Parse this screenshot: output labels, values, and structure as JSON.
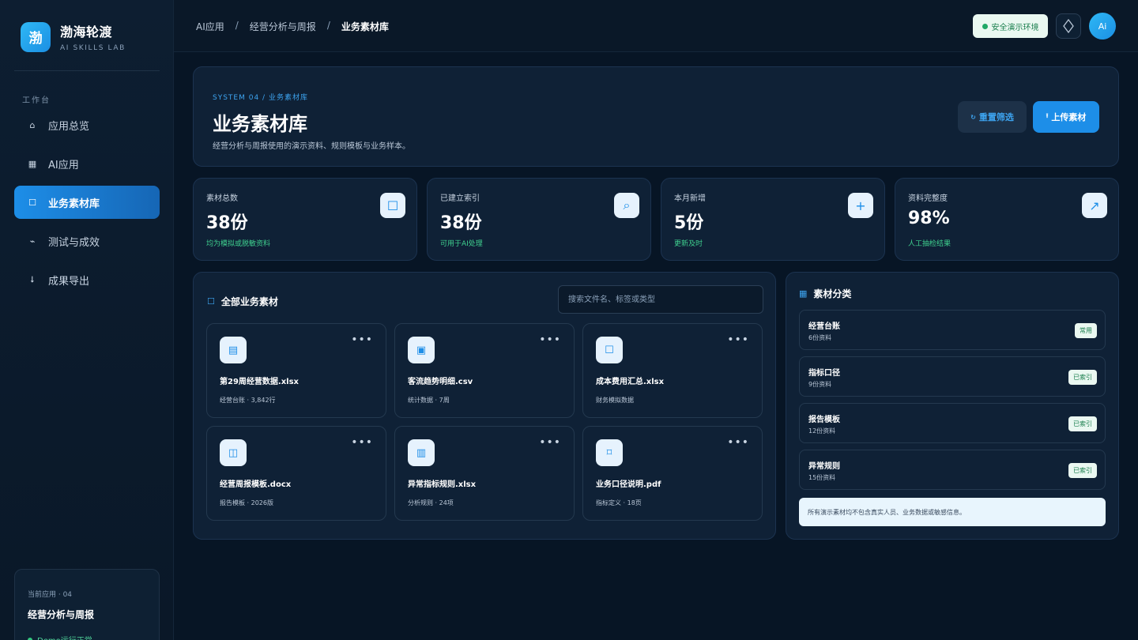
{
  "brand": {
    "logo_char": "渤",
    "name": "渤海轮渡",
    "sub": "AI SKILLS LAB"
  },
  "sidebar": {
    "section": "工作台",
    "items": [
      {
        "label": "应用总览",
        "icon": "home-icon",
        "glyph": "⌂",
        "active": false
      },
      {
        "label": "AI应用",
        "icon": "grid-icon",
        "glyph": "▦",
        "active": false
      },
      {
        "label": "业务素材库",
        "icon": "folder-icon",
        "glyph": "☐",
        "active": true
      },
      {
        "label": "测试与成效",
        "icon": "pulse-icon",
        "glyph": "⌁",
        "active": false
      },
      {
        "label": "成果导出",
        "icon": "download-icon",
        "glyph": "⭣",
        "active": false
      }
    ],
    "current_app": {
      "label": "当前应用 · 04",
      "name": "经营分析与周报",
      "status": "Demo运行正常"
    }
  },
  "topbar": {
    "breadcrumb": [
      "AI应用",
      "经营分析与周报",
      "业务素材库"
    ],
    "separator": "/",
    "env_badge": "安全演示环境",
    "avatar": "Ai"
  },
  "hero": {
    "eyebrow": "SYSTEM 04 / 业务素材库",
    "title": "业务素材库",
    "desc": "经营分析与周报使用的演示资料、规则模板与业务样本。",
    "reset_label": "重置筛选",
    "upload_label": "上传素材"
  },
  "stats": [
    {
      "label": "素材总数",
      "value": "38份",
      "note": "均为模拟或脱敏资料",
      "icon": "folder-icon",
      "glyph": "☐"
    },
    {
      "label": "已建立索引",
      "value": "38份",
      "note": "可用于AI处理",
      "icon": "search-icon",
      "glyph": "⌕"
    },
    {
      "label": "本月新增",
      "value": "5份",
      "note": "更新及时",
      "icon": "plus-icon",
      "glyph": "+"
    },
    {
      "label": "资料完整度",
      "value": "98%",
      "note": "人工抽检结果",
      "icon": "trend-arrow-icon",
      "glyph": "↗"
    }
  ],
  "materials": {
    "title": "全部业务素材",
    "search_placeholder": "搜索文件名、标签或类型",
    "more": "•••",
    "files": [
      {
        "name": "第29周经营数据.xlsx",
        "meta": "经营台账 · 3,842行",
        "icon": "spreadsheet-icon",
        "glyph": "▤"
      },
      {
        "name": "客流趋势明细.csv",
        "meta": "统计数据 · 7周",
        "icon": "chart-file-icon",
        "glyph": "▣"
      },
      {
        "name": "成本费用汇总.xlsx",
        "meta": "财务模拟数据",
        "icon": "document-icon",
        "glyph": "☐"
      },
      {
        "name": "经营周报模板.docx",
        "meta": "报告模板 · 2026版",
        "icon": "template-icon",
        "glyph": "◫"
      },
      {
        "name": "异常指标规则.xlsx",
        "meta": "分析规则 · 24项",
        "icon": "rules-icon",
        "glyph": "▥"
      },
      {
        "name": "业务口径说明.pdf",
        "meta": "指标定义 · 18页",
        "icon": "pdf-icon",
        "glyph": "⌑"
      }
    ]
  },
  "categories": {
    "title": "素材分类",
    "items": [
      {
        "name": "经营台账",
        "count": "6份资料",
        "badge": "常用"
      },
      {
        "name": "指标口径",
        "count": "9份资料",
        "badge": "已索引"
      },
      {
        "name": "报告模板",
        "count": "12份资料",
        "badge": "已索引"
      },
      {
        "name": "异常规则",
        "count": "15份资料",
        "badge": "已索引"
      }
    ],
    "note": "所有演示素材均不包含真实人员、业务数据或敏感信息。"
  }
}
